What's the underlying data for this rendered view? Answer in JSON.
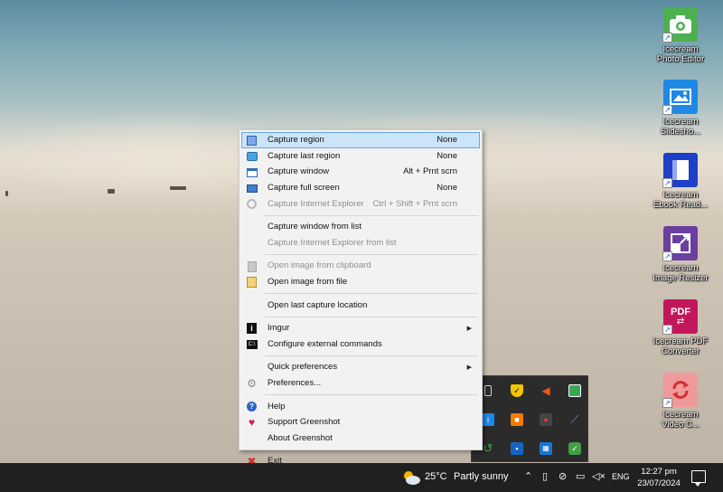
{
  "desktop_icons": [
    {
      "label_line1": "Icecream",
      "label_line2": "Photo Editor",
      "color": "#4caf50",
      "icon": "camera-icon"
    },
    {
      "label_line1": "Icecream",
      "label_line2": "Slidesho...",
      "color": "#1e88e5",
      "icon": "slideshow-icon"
    },
    {
      "label_line1": "Icecream",
      "label_line2": "Ebook Read...",
      "color": "#1e40c8",
      "icon": "ebook-icon"
    },
    {
      "label_line1": "Icecream",
      "label_line2": "Image Resizer",
      "color": "#6a3fa0",
      "icon": "resize-icon"
    },
    {
      "label_line1": "Icecream PDF",
      "label_line2": "Converter",
      "color": "#c2185b",
      "icon": "pdf-icon",
      "tile_text": "PDF"
    },
    {
      "label_line1": "Icecream",
      "label_line2": "Video C...",
      "color": "#e57373",
      "icon": "video-converter-icon"
    }
  ],
  "menu": {
    "capture_region": {
      "label": "Capture region",
      "shortcut": "None"
    },
    "capture_last_region": {
      "label": "Capture last region",
      "shortcut": "None"
    },
    "capture_window": {
      "label": "Capture window",
      "shortcut": "Alt + Prnt scrn"
    },
    "capture_full_screen": {
      "label": "Capture full screen",
      "shortcut": "None"
    },
    "capture_ie": {
      "label": "Capture Internet Explorer",
      "shortcut": "Ctrl + Shift + Prnt scrn"
    },
    "capture_window_from_list": {
      "label": "Capture window from list"
    },
    "capture_ie_from_list": {
      "label": "Capture Internet Explorer from list"
    },
    "open_clipboard": {
      "label": "Open image from clipboard"
    },
    "open_file": {
      "label": "Open image from file"
    },
    "open_last_location": {
      "label": "Open last capture location"
    },
    "imgur": {
      "label": "Imgur"
    },
    "external_commands": {
      "label": "Configure external commands"
    },
    "quick_prefs": {
      "label": "Quick preferences"
    },
    "preferences": {
      "label": "Preferences..."
    },
    "help": {
      "label": "Help"
    },
    "support": {
      "label": "Support Greenshot"
    },
    "about": {
      "label": "About Greenshot"
    },
    "exit": {
      "label": "Exit"
    }
  },
  "tray_icons": [
    {
      "name": "usb-drive-icon",
      "color": "#d0d0d0"
    },
    {
      "name": "security-shield-icon",
      "color": "#f5c400"
    },
    {
      "name": "speaker-orange-icon",
      "color": "#e8591a"
    },
    {
      "name": "monitor-network-icon",
      "color": "#3aa655"
    },
    {
      "name": "info-app-icon",
      "color": "#1e88e5"
    },
    {
      "name": "orange-app-icon",
      "color": "#f57c00"
    },
    {
      "name": "recorder-icon",
      "color": "#444444"
    },
    {
      "name": "feather-icon",
      "color": "#7e57c2"
    },
    {
      "name": "green-tray-icon",
      "color": "#2e7d32"
    },
    {
      "name": "blue-app-icon",
      "color": "#1565c0"
    },
    {
      "name": "grid-app-icon",
      "color": "#1976d2"
    },
    {
      "name": "checkmark-app-icon",
      "color": "#43a047"
    }
  ],
  "taskbar": {
    "temperature": "25°C",
    "condition": "Partly sunny",
    "language": "ENG",
    "time": "12:27 pm",
    "date": "23/07/2024"
  }
}
